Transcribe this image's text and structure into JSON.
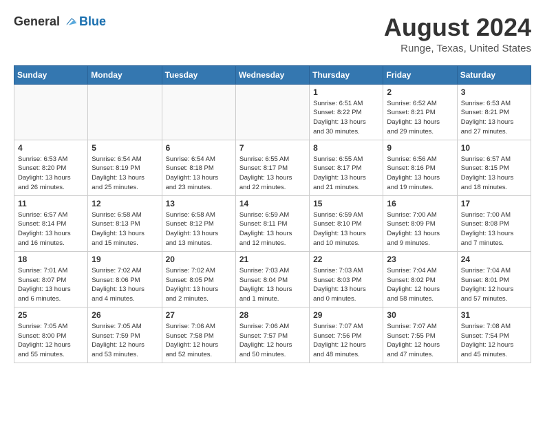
{
  "logo": {
    "general": "General",
    "blue": "Blue"
  },
  "title": "August 2024",
  "location": "Runge, Texas, United States",
  "days_of_week": [
    "Sunday",
    "Monday",
    "Tuesday",
    "Wednesday",
    "Thursday",
    "Friday",
    "Saturday"
  ],
  "weeks": [
    [
      {
        "day": "",
        "info": ""
      },
      {
        "day": "",
        "info": ""
      },
      {
        "day": "",
        "info": ""
      },
      {
        "day": "",
        "info": ""
      },
      {
        "day": "1",
        "info": "Sunrise: 6:51 AM\nSunset: 8:22 PM\nDaylight: 13 hours\nand 30 minutes."
      },
      {
        "day": "2",
        "info": "Sunrise: 6:52 AM\nSunset: 8:21 PM\nDaylight: 13 hours\nand 29 minutes."
      },
      {
        "day": "3",
        "info": "Sunrise: 6:53 AM\nSunset: 8:21 PM\nDaylight: 13 hours\nand 27 minutes."
      }
    ],
    [
      {
        "day": "4",
        "info": "Sunrise: 6:53 AM\nSunset: 8:20 PM\nDaylight: 13 hours\nand 26 minutes."
      },
      {
        "day": "5",
        "info": "Sunrise: 6:54 AM\nSunset: 8:19 PM\nDaylight: 13 hours\nand 25 minutes."
      },
      {
        "day": "6",
        "info": "Sunrise: 6:54 AM\nSunset: 8:18 PM\nDaylight: 13 hours\nand 23 minutes."
      },
      {
        "day": "7",
        "info": "Sunrise: 6:55 AM\nSunset: 8:17 PM\nDaylight: 13 hours\nand 22 minutes."
      },
      {
        "day": "8",
        "info": "Sunrise: 6:55 AM\nSunset: 8:17 PM\nDaylight: 13 hours\nand 21 minutes."
      },
      {
        "day": "9",
        "info": "Sunrise: 6:56 AM\nSunset: 8:16 PM\nDaylight: 13 hours\nand 19 minutes."
      },
      {
        "day": "10",
        "info": "Sunrise: 6:57 AM\nSunset: 8:15 PM\nDaylight: 13 hours\nand 18 minutes."
      }
    ],
    [
      {
        "day": "11",
        "info": "Sunrise: 6:57 AM\nSunset: 8:14 PM\nDaylight: 13 hours\nand 16 minutes."
      },
      {
        "day": "12",
        "info": "Sunrise: 6:58 AM\nSunset: 8:13 PM\nDaylight: 13 hours\nand 15 minutes."
      },
      {
        "day": "13",
        "info": "Sunrise: 6:58 AM\nSunset: 8:12 PM\nDaylight: 13 hours\nand 13 minutes."
      },
      {
        "day": "14",
        "info": "Sunrise: 6:59 AM\nSunset: 8:11 PM\nDaylight: 13 hours\nand 12 minutes."
      },
      {
        "day": "15",
        "info": "Sunrise: 6:59 AM\nSunset: 8:10 PM\nDaylight: 13 hours\nand 10 minutes."
      },
      {
        "day": "16",
        "info": "Sunrise: 7:00 AM\nSunset: 8:09 PM\nDaylight: 13 hours\nand 9 minutes."
      },
      {
        "day": "17",
        "info": "Sunrise: 7:00 AM\nSunset: 8:08 PM\nDaylight: 13 hours\nand 7 minutes."
      }
    ],
    [
      {
        "day": "18",
        "info": "Sunrise: 7:01 AM\nSunset: 8:07 PM\nDaylight: 13 hours\nand 6 minutes."
      },
      {
        "day": "19",
        "info": "Sunrise: 7:02 AM\nSunset: 8:06 PM\nDaylight: 13 hours\nand 4 minutes."
      },
      {
        "day": "20",
        "info": "Sunrise: 7:02 AM\nSunset: 8:05 PM\nDaylight: 13 hours\nand 2 minutes."
      },
      {
        "day": "21",
        "info": "Sunrise: 7:03 AM\nSunset: 8:04 PM\nDaylight: 13 hours\nand 1 minute."
      },
      {
        "day": "22",
        "info": "Sunrise: 7:03 AM\nSunset: 8:03 PM\nDaylight: 13 hours\nand 0 minutes."
      },
      {
        "day": "23",
        "info": "Sunrise: 7:04 AM\nSunset: 8:02 PM\nDaylight: 12 hours\nand 58 minutes."
      },
      {
        "day": "24",
        "info": "Sunrise: 7:04 AM\nSunset: 8:01 PM\nDaylight: 12 hours\nand 57 minutes."
      }
    ],
    [
      {
        "day": "25",
        "info": "Sunrise: 7:05 AM\nSunset: 8:00 PM\nDaylight: 12 hours\nand 55 minutes."
      },
      {
        "day": "26",
        "info": "Sunrise: 7:05 AM\nSunset: 7:59 PM\nDaylight: 12 hours\nand 53 minutes."
      },
      {
        "day": "27",
        "info": "Sunrise: 7:06 AM\nSunset: 7:58 PM\nDaylight: 12 hours\nand 52 minutes."
      },
      {
        "day": "28",
        "info": "Sunrise: 7:06 AM\nSunset: 7:57 PM\nDaylight: 12 hours\nand 50 minutes."
      },
      {
        "day": "29",
        "info": "Sunrise: 7:07 AM\nSunset: 7:56 PM\nDaylight: 12 hours\nand 48 minutes."
      },
      {
        "day": "30",
        "info": "Sunrise: 7:07 AM\nSunset: 7:55 PM\nDaylight: 12 hours\nand 47 minutes."
      },
      {
        "day": "31",
        "info": "Sunrise: 7:08 AM\nSunset: 7:54 PM\nDaylight: 12 hours\nand 45 minutes."
      }
    ]
  ]
}
